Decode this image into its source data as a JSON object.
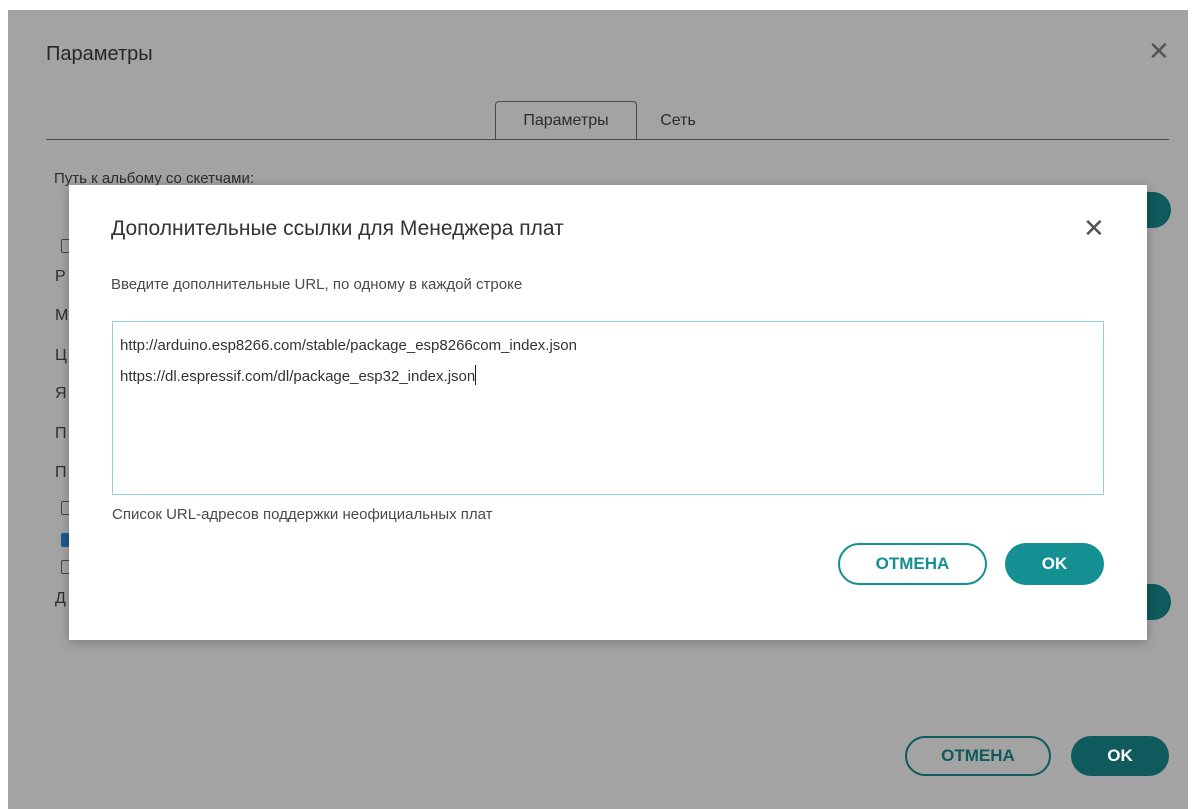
{
  "background_dialog": {
    "title": "Параметры",
    "close_glyph": "✕",
    "tabs": [
      {
        "label": "Параметры",
        "active": true
      },
      {
        "label": "Сеть",
        "active": false
      }
    ],
    "sketchbook_label": "Путь к альбому со скетчами:",
    "partial_letters": [
      "Р",
      "М",
      "Ц",
      "Я",
      "П",
      "П",
      "Д"
    ],
    "cancel_label": "ОТМЕНА",
    "ok_label": "OK"
  },
  "modal": {
    "title": "Дополнительные ссылки для Менеджера плат",
    "close_glyph": "✕",
    "instruction": "Введите дополнительные URL, по одному в каждой строке",
    "urls": [
      "http://arduino.esp8266.com/stable/package_esp8266com_index.json",
      "https://dl.espressif.com/dl/package_esp32_index.json"
    ],
    "help_text": "Список URL-адресов поддержки неофициальных плат",
    "cancel_label": "ОТМЕНА",
    "ok_label": "OK"
  },
  "colors": {
    "accent": "#148f92",
    "accent_dim": "#0e5a5c",
    "overlay": "#a3a3a3"
  }
}
